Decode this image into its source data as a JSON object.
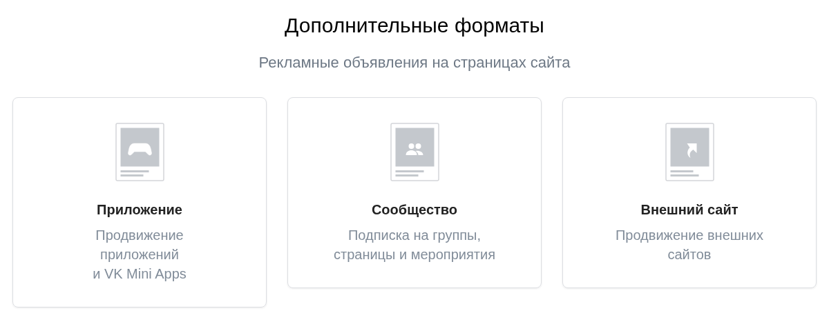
{
  "title": "Дополнительные форматы",
  "subtitle": "Рекламные объявления на страницах сайта",
  "cards": [
    {
      "kind": "game",
      "title": "Приложение",
      "description": "Продвижение\nприложений\nи VK Mini Apps"
    },
    {
      "kind": "people",
      "title": "Сообщество",
      "description": "Подписка на группы,\nстраницы и мероприятия"
    },
    {
      "kind": "link",
      "title": "Внешний сайт",
      "description": "Продвижение внешних\nсайтов"
    }
  ]
}
